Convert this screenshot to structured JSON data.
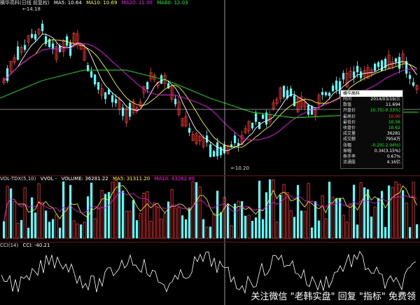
{
  "legend": {
    "main": {
      "title": "横华高科(日线 前复权)",
      "items": [
        {
          "label": "MA5: 10.64",
          "color": "#ffffff"
        },
        {
          "label": "MA10: 10.69",
          "color": "#ffff00"
        },
        {
          "label": "MA20: 11.05",
          "color": "#ff00ff"
        },
        {
          "label": "MA60: 12.03",
          "color": "#00ff00"
        }
      ]
    },
    "volume": {
      "title": "VOL-TDX(5,10)",
      "items": [
        {
          "label": "VVOL -",
          "color": "#ffffff"
        },
        {
          "label": "VOLUME: 36281.22",
          "color": "#ffffff"
        },
        {
          "label": "MA5: 31311.20",
          "color": "#ffff00"
        },
        {
          "label": "MA10: 43282.80",
          "color": "#ff00ff"
        }
      ]
    },
    "cci": {
      "title": "CCI(14)",
      "items": [
        {
          "label": "CCI: -40.21",
          "color": "#ffffff"
        }
      ]
    }
  },
  "price_labels": {
    "high": "14.18",
    "low": "10.20"
  },
  "info_panel": {
    "title": "横华高科",
    "rows": [
      {
        "k": "时间",
        "v": "2014/03/19/三",
        "color": "#ffffff"
      },
      {
        "k": "数值",
        "v": "11.694",
        "color": "#ffffff"
      },
      {
        "k": "开盘价",
        "v": "10.75(-0.33%)",
        "color": "#00ff00"
      },
      {
        "k": "最高价",
        "v": "10.90",
        "color": "#ff3030"
      },
      {
        "k": "最低价",
        "v": "10.56",
        "color": "#00ff00"
      },
      {
        "k": "收盘价",
        "v": "10.62",
        "color": "#00ff00"
      },
      {
        "k": "成交量",
        "v": "36281",
        "color": "#ffffff"
      },
      {
        "k": "成交额",
        "v": "7954万",
        "color": "#ffffff"
      },
      {
        "k": "涨幅",
        "v": "-0.20(-2.04%)",
        "color": "#00ff00"
      },
      {
        "k": "振幅",
        "v": "0.34(3.15%)",
        "color": "#ffffff"
      },
      {
        "k": "换手率",
        "v": "0.67%",
        "color": "#ffffff"
      },
      {
        "k": "流通股",
        "v": "4.16亿",
        "color": "#ffffff"
      }
    ]
  },
  "watermark": "关注微信 \"老韩实盘\" 回复 \"指标\" 免费领",
  "colors": {
    "up": "#ff3333",
    "down": "#54ffff",
    "ma5": "#ffffff",
    "ma10": "#ffff00",
    "ma20": "#ff00ff",
    "ma60": "#00ff00",
    "crosshair": "#ffffff"
  }
}
